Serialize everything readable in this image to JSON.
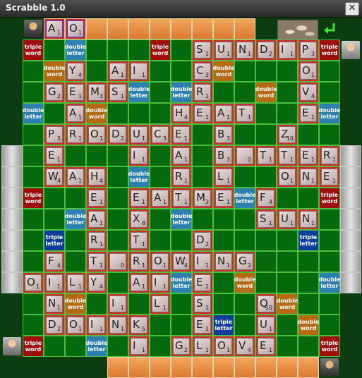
{
  "window": {
    "title": "Scrabble 1.0",
    "close_label": "✕"
  },
  "premium_labels": {
    "tw": "triple word",
    "dw": "double word",
    "dl": "double letter",
    "tl": "triple letter"
  },
  "colors": {
    "tile_border": "#d32a2a",
    "board_green": "#07690d",
    "grid_line": "#49c13f",
    "triple_word": "#a00d0d",
    "double_word": "#b66a15",
    "double_letter": "#2c7fb0",
    "triple_letter": "#0e3c9a"
  },
  "icons": {
    "top_left_avatar": "player-avatar-icon",
    "top_right_avatar": "player-avatar-icon",
    "bottom_left_avatar": "player-avatar-icon",
    "bottom_right_avatar": "player-avatar-icon",
    "tile_bag": "tile-bag-icon",
    "submit": "return-arrow-icon"
  },
  "top_rack": [
    {
      "letter": "A",
      "score": "1"
    },
    {
      "letter": "O",
      "score": "1"
    },
    null,
    null,
    null,
    null,
    null,
    null,
    null,
    null
  ],
  "bottom_rack": [
    null,
    null,
    null,
    null,
    null,
    null,
    null,
    null,
    null,
    null
  ],
  "board_premiums": [
    "tw . dl . . . tw . . . . . . . tw",
    ". dw . . . . . . . dw . . . dw .",
    ". . . . . dl . dl . . . dw . . .",
    "dl . . dw . . . . . . dw . . . dl",
    ". . . . . . . . . dw . . . . .",
    ". . . . . . . . . . . . . . .",
    ". . . . . dl . dl . . . . . . .",
    "tw . . . . . . . . . dl . . . tw",
    ". . dl . . dl . dl . . . . . . .",
    ". tl . . . . . . tl . . . . tl .",
    ". . . . . . . . . . . . . . .",
    ". . . . . . . dl . . dw . . . dl",
    ". . dw . . . . . . . . . dw . .",
    ". . . . . . . . . tl . . . dw .",
    "tw . . dl . . . . . . . . . . tw"
  ],
  "board_tiles": [
    [
      null,
      null,
      null,
      null,
      null,
      null,
      null,
      null,
      {
        "letter": "S",
        "score": "1"
      },
      {
        "letter": "U",
        "score": "1"
      },
      {
        "letter": "N",
        "score": "1"
      },
      {
        "letter": "D",
        "score": "2"
      },
      {
        "letter": "I",
        "score": "1"
      },
      {
        "letter": "P",
        "score": "3"
      },
      null
    ],
    [
      null,
      null,
      {
        "letter": "Y",
        "score": "4"
      },
      null,
      {
        "letter": "A",
        "score": "1"
      },
      {
        "letter": "I",
        "score": "1"
      },
      null,
      null,
      {
        "letter": "C",
        "score": "3"
      },
      null,
      null,
      null,
      null,
      {
        "letter": "O",
        "score": "1"
      },
      null
    ],
    [
      null,
      {
        "letter": "G",
        "score": "2"
      },
      {
        "letter": "E",
        "score": "1"
      },
      {
        "letter": "M",
        "score": "3"
      },
      {
        "letter": "S",
        "score": "1"
      },
      null,
      null,
      null,
      {
        "letter": "R",
        "score": "1"
      },
      null,
      null,
      null,
      null,
      {
        "letter": "V",
        "score": "4"
      },
      null
    ],
    [
      null,
      null,
      {
        "letter": "A",
        "score": "1"
      },
      null,
      null,
      null,
      null,
      {
        "letter": "H",
        "score": "4"
      },
      {
        "letter": "E",
        "score": "1"
      },
      {
        "letter": "A",
        "score": "1"
      },
      {
        "letter": "T",
        "score": "1"
      },
      null,
      null,
      {
        "letter": "E",
        "score": "1"
      },
      null
    ],
    [
      null,
      {
        "letter": "P",
        "score": "3"
      },
      {
        "letter": "R",
        "score": "1"
      },
      {
        "letter": "O",
        "score": "1"
      },
      {
        "letter": "D",
        "score": "2"
      },
      {
        "letter": "U",
        "score": "1"
      },
      {
        "letter": "C",
        "score": "3"
      },
      {
        "letter": "E",
        "score": "1"
      },
      null,
      {
        "letter": "B",
        "score": "3"
      },
      null,
      null,
      {
        "letter": "Z",
        "score": "10"
      },
      null,
      null
    ],
    [
      null,
      {
        "letter": "E",
        "score": "1"
      },
      null,
      null,
      null,
      {
        "letter": "I",
        "score": "1"
      },
      null,
      {
        "letter": "A",
        "score": "1"
      },
      null,
      {
        "letter": "B",
        "score": "3"
      },
      {
        "letter": "",
        "score": "0"
      },
      {
        "letter": "T",
        "score": "1"
      },
      {
        "letter": "T",
        "score": "1"
      },
      {
        "letter": "E",
        "score": "1"
      },
      {
        "letter": "R",
        "score": "1"
      }
    ],
    [
      null,
      {
        "letter": "W",
        "score": "4"
      },
      {
        "letter": "A",
        "score": "1"
      },
      {
        "letter": "H",
        "score": "4"
      },
      null,
      null,
      null,
      {
        "letter": "R",
        "score": "1"
      },
      null,
      {
        "letter": "L",
        "score": "1"
      },
      null,
      null,
      {
        "letter": "O",
        "score": "1"
      },
      {
        "letter": "N",
        "score": "1"
      },
      {
        "letter": "E",
        "score": "1"
      }
    ],
    [
      null,
      null,
      null,
      {
        "letter": "E",
        "score": "1"
      },
      null,
      {
        "letter": "E",
        "score": "1"
      },
      {
        "letter": "A",
        "score": "1"
      },
      {
        "letter": "T",
        "score": "1"
      },
      {
        "letter": "M",
        "score": "3"
      },
      {
        "letter": "E",
        "score": "1"
      },
      null,
      {
        "letter": "F",
        "score": "4"
      },
      null,
      null,
      null
    ],
    [
      null,
      null,
      null,
      {
        "letter": "A",
        "score": "1"
      },
      null,
      {
        "letter": "X",
        "score": "8"
      },
      null,
      null,
      null,
      null,
      null,
      {
        "letter": "S",
        "score": "1"
      },
      {
        "letter": "U",
        "score": "1"
      },
      {
        "letter": "N",
        "score": "1"
      },
      null
    ],
    [
      null,
      null,
      null,
      {
        "letter": "R",
        "score": "1"
      },
      null,
      {
        "letter": "T",
        "score": "1"
      },
      null,
      null,
      {
        "letter": "D",
        "score": "2"
      },
      null,
      null,
      null,
      null,
      null,
      null
    ],
    [
      null,
      {
        "letter": "F",
        "score": "4"
      },
      null,
      {
        "letter": "T",
        "score": "1"
      },
      {
        "letter": "",
        "score": "0"
      },
      {
        "letter": "R",
        "score": "1"
      },
      {
        "letter": "O",
        "score": "1"
      },
      {
        "letter": "W",
        "score": "4"
      },
      {
        "letter": "I",
        "score": "1"
      },
      {
        "letter": "N",
        "score": "1"
      },
      {
        "letter": "G",
        "score": "2"
      },
      null,
      null,
      null,
      null
    ],
    [
      {
        "letter": "O",
        "score": "1"
      },
      {
        "letter": "I",
        "score": "1"
      },
      {
        "letter": "L",
        "score": "1"
      },
      {
        "letter": "Y",
        "score": "4"
      },
      null,
      {
        "letter": "A",
        "score": "1"
      },
      {
        "letter": "I",
        "score": "1"
      },
      null,
      {
        "letter": "E",
        "score": "1"
      },
      null,
      null,
      null,
      null,
      null,
      null
    ],
    [
      null,
      {
        "letter": "N",
        "score": "1"
      },
      null,
      null,
      {
        "letter": "I",
        "score": "1"
      },
      null,
      {
        "letter": "L",
        "score": "1"
      },
      null,
      {
        "letter": "S",
        "score": "1"
      },
      null,
      null,
      {
        "letter": "Q",
        "score": "10"
      },
      null,
      null,
      null
    ],
    [
      null,
      {
        "letter": "D",
        "score": "2"
      },
      {
        "letter": "O",
        "score": "1"
      },
      {
        "letter": "I",
        "score": "1"
      },
      {
        "letter": "N",
        "score": "1"
      },
      {
        "letter": "K",
        "score": "5"
      },
      null,
      null,
      {
        "letter": "E",
        "score": "1"
      },
      null,
      null,
      {
        "letter": "U",
        "score": "1"
      },
      null,
      null,
      null
    ],
    [
      null,
      null,
      null,
      null,
      null,
      {
        "letter": "I",
        "score": "1"
      },
      null,
      {
        "letter": "G",
        "score": "2"
      },
      {
        "letter": "L",
        "score": "1"
      },
      {
        "letter": "O",
        "score": "1"
      },
      {
        "letter": "V",
        "score": "4"
      },
      {
        "letter": "E",
        "score": "1"
      },
      null,
      null,
      null
    ]
  ]
}
